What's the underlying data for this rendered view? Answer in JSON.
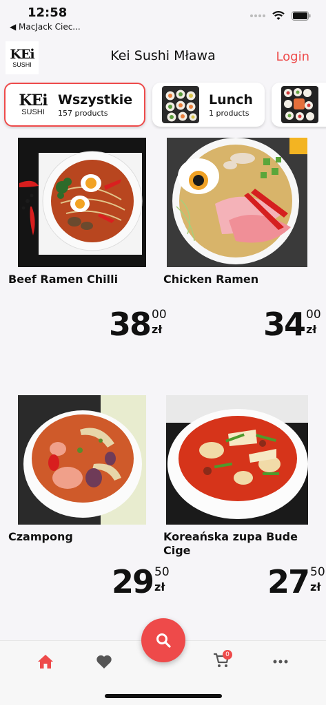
{
  "status_bar": {
    "time": "12:58",
    "back_app": "◀ MacJack Ciec..."
  },
  "header": {
    "logo_top": "KEi",
    "logo_bottom": "SUSHI",
    "title": "Kei Sushi Mława",
    "login": "Login"
  },
  "categories": [
    {
      "name": "Wszystkie",
      "count": "157 products",
      "selected": true
    },
    {
      "name": "Lunch",
      "count": "1 products",
      "selected": false
    },
    {
      "name": "",
      "count": "",
      "selected": false
    }
  ],
  "products": [
    {
      "name": "Beef Ramen Chilli",
      "price_int": "38",
      "price_dec": "00",
      "currency": "zł"
    },
    {
      "name": "Chicken Ramen",
      "price_int": "34",
      "price_dec": "00",
      "currency": "zł"
    },
    {
      "name": "Czampong",
      "price_int": "29",
      "price_dec": "50",
      "currency": "zł"
    },
    {
      "name": "Koreańska zupa Bude Cige",
      "price_int": "27",
      "price_dec": "50",
      "currency": "zł"
    }
  ],
  "tabbar": {
    "items": [
      "home-icon",
      "heart-icon",
      "search-icon",
      "cart-icon",
      "more-icon"
    ],
    "cart_badge": "0",
    "active_color": "#ee4a4a",
    "inactive_color": "#555555"
  },
  "colors": {
    "accent": "#ee4a4a",
    "background": "#f6f5f8"
  }
}
